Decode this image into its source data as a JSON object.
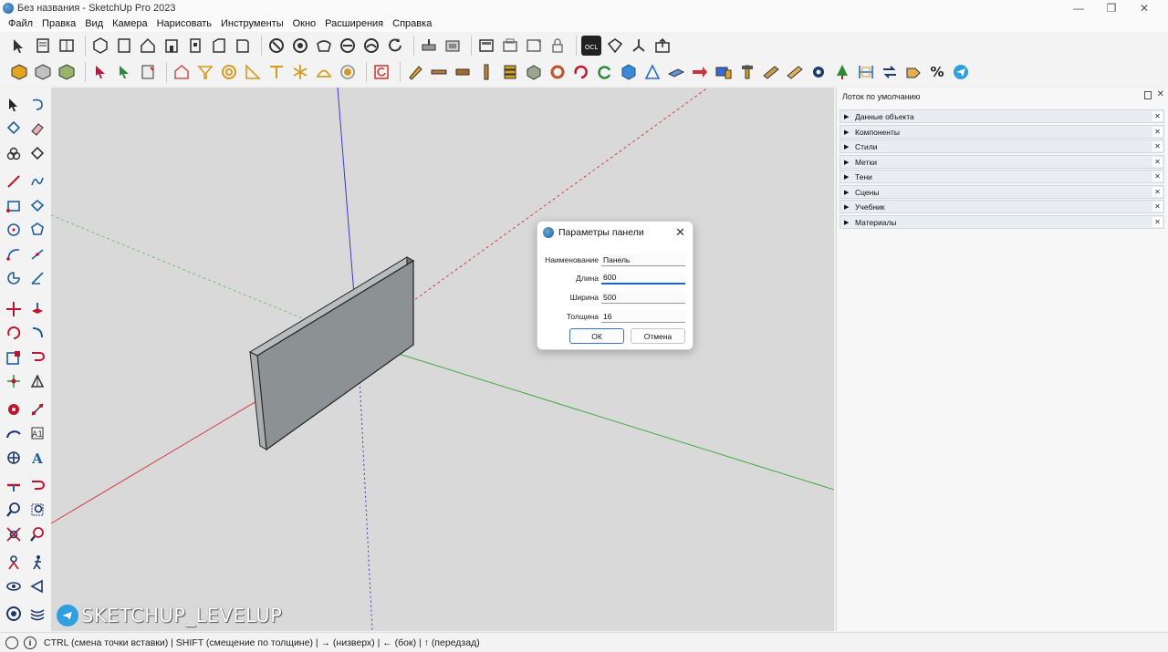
{
  "window": {
    "title": "Без названия - SketchUp Pro 2023",
    "min_glyph": "—",
    "max_glyph": "❐",
    "close_glyph": "✕"
  },
  "menu": [
    "Файл",
    "Правка",
    "Вид",
    "Камера",
    "Нарисовать",
    "Инструменты",
    "Окно",
    "Расширения",
    "Справка"
  ],
  "dialog": {
    "title": "Параметры панели",
    "close_glyph": "✕",
    "fields": [
      {
        "label": "Наименование",
        "value": "Панель"
      },
      {
        "label": "Длина",
        "value": "600"
      },
      {
        "label": "Ширина",
        "value": "500"
      },
      {
        "label": "Толщина",
        "value": "16"
      }
    ],
    "ok_label": "ОК",
    "cancel_label": "Отмена"
  },
  "tray": {
    "title": "Лоток по умолчанию",
    "panels": [
      "Данные объекта",
      "Компоненты",
      "Стили",
      "Метки",
      "Тени",
      "Сцены",
      "Учебник",
      "Материалы"
    ],
    "arrow_glyph": "▶",
    "close_glyph": "✕"
  },
  "watermark": {
    "text": "SKETCHUP_LEVELUP"
  },
  "status": {
    "text": "CTRL (смена точки вставки) | SHIFT (смещение по толщине) | → (низверх) | ← (бок) | ↑ (передзад)"
  },
  "icons": {
    "toolbar1": [
      "select-icon",
      "components-icon",
      "make-component-icon",
      "home-icon",
      "iso-view-icon",
      "top-view-icon",
      "front-view-icon",
      "right-view-icon",
      "back-view-icon",
      "left-view-icon",
      "xray-icon",
      "back-edges-icon",
      "wireframe-icon",
      "hidden-line-icon",
      "shaded-icon",
      "monochrome-icon",
      "section-plane-icon",
      "section-cut-icon",
      "display-sections-icon",
      "ocl-icon",
      "export-icon",
      "axes-icon",
      "share-icon"
    ],
    "toolbar2": [
      "material-icon",
      "component-icon",
      "group-icon",
      "select-arrow-icon",
      "paint-arrow-icon",
      "book-icon",
      "house-icon",
      "funnel-icon",
      "circle-icon",
      "ruler-icon",
      "text-icon",
      "asterisk-icon",
      "dome-icon",
      "sphere-icon",
      "refresh-icon",
      "pencil-icon",
      "board-icon",
      "plank-icon",
      "pillar-icon",
      "stack-icon",
      "box-icon",
      "ring-icon",
      "rotate-icon",
      "cycle-icon",
      "cube-icon",
      "line-tool-icon",
      "panel-icon",
      "arrow-icon",
      "drill-icon",
      "saw-icon",
      "wood-icon",
      "gear-icon",
      "tree-icon",
      "dimension-icon",
      "swap-icon",
      "tag-icon",
      "percent-icon",
      "telegram-icon"
    ]
  },
  "colors": {
    "viewport_bg": "#d9d9d9",
    "axis_red": "#d44040",
    "axis_green": "#3bad3b",
    "axis_blue": "#3a3ad0",
    "panel_face": "#8c9294",
    "accent": "#1a64c8"
  }
}
